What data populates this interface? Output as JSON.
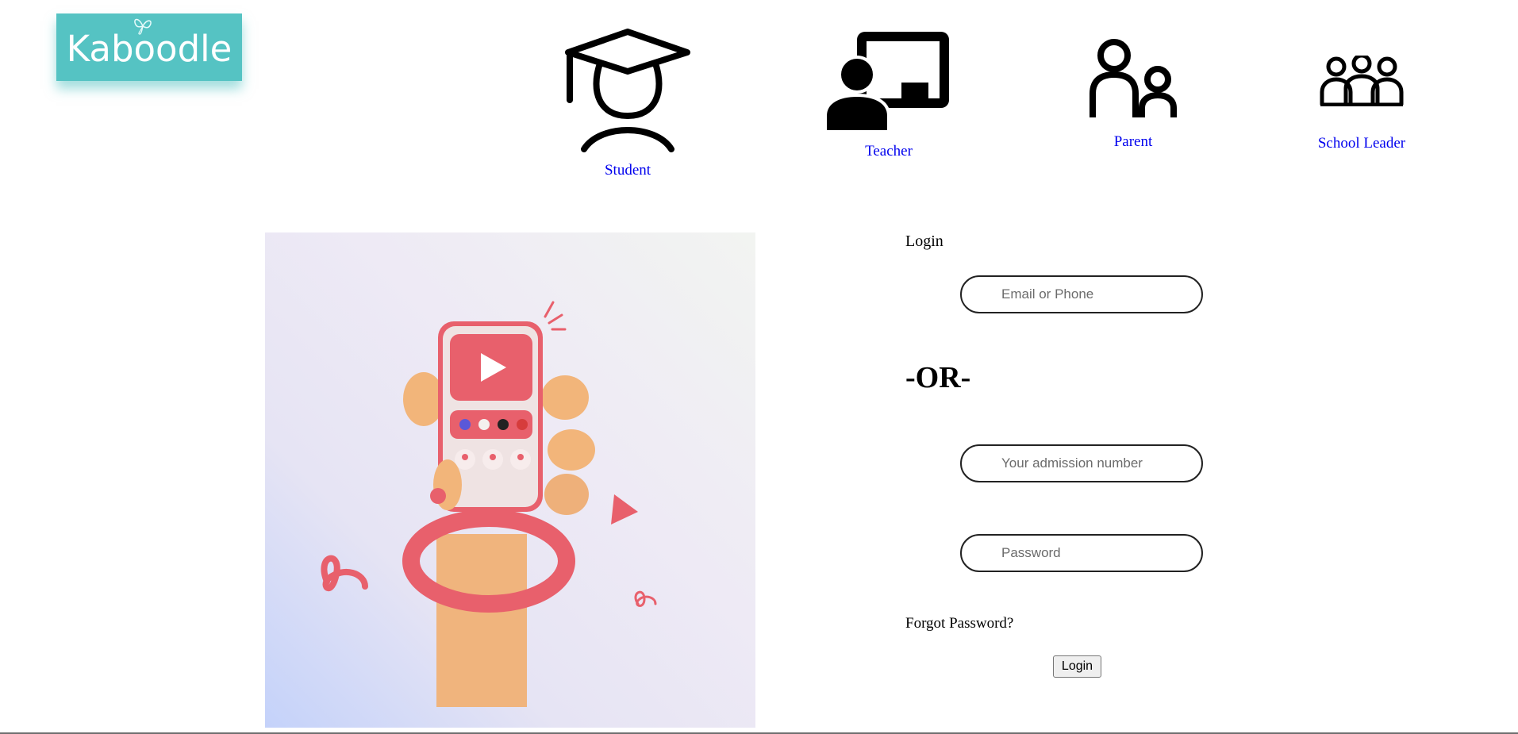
{
  "logo": {
    "text": "Kaboodle",
    "color": "#55c3c3"
  },
  "roles": [
    {
      "label": "Student",
      "icon": "graduation-cap-person-icon"
    },
    {
      "label": "Teacher",
      "icon": "teacher-board-icon"
    },
    {
      "label": "Parent",
      "icon": "parent-child-icon"
    },
    {
      "label": "School Leader",
      "icon": "group-people-icon"
    }
  ],
  "login": {
    "title": "Login",
    "email_placeholder": "Email or Phone",
    "or_text": "-OR-",
    "admission_placeholder": "Your admission number",
    "password_placeholder": "Password",
    "forgot_text": "Forgot Password?",
    "button_label": "Login"
  },
  "colors": {
    "link": "#0000ee",
    "brand": "#55c3c3",
    "accent": "#e8606c"
  }
}
